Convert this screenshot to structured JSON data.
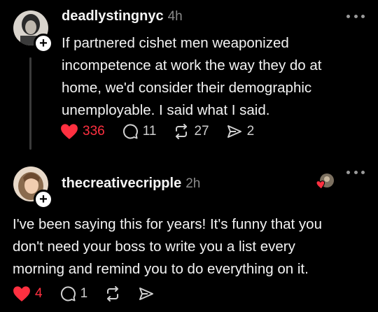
{
  "posts": [
    {
      "username": "deadlystingnyc",
      "time": "4h",
      "text": "If partnered cishet men weaponized\nincompetence at work the way they do at\nhome, we'd consider their demographic\nunemployable. I said what I said.",
      "likes": "336",
      "replies": "11",
      "reposts": "27",
      "shares": "2"
    },
    {
      "username": "thecreativecripple",
      "time": "2h",
      "text": "I've been saying this for years!  It's funny that you\ndon't need your boss to write you a list every\nmorning and remind you to do everything on it.",
      "likes": "4",
      "replies": "1",
      "reposts": "",
      "shares": ""
    }
  ],
  "colors": {
    "background": "#000000",
    "like_red": "#ff3040",
    "muted": "#8a8a8a"
  }
}
